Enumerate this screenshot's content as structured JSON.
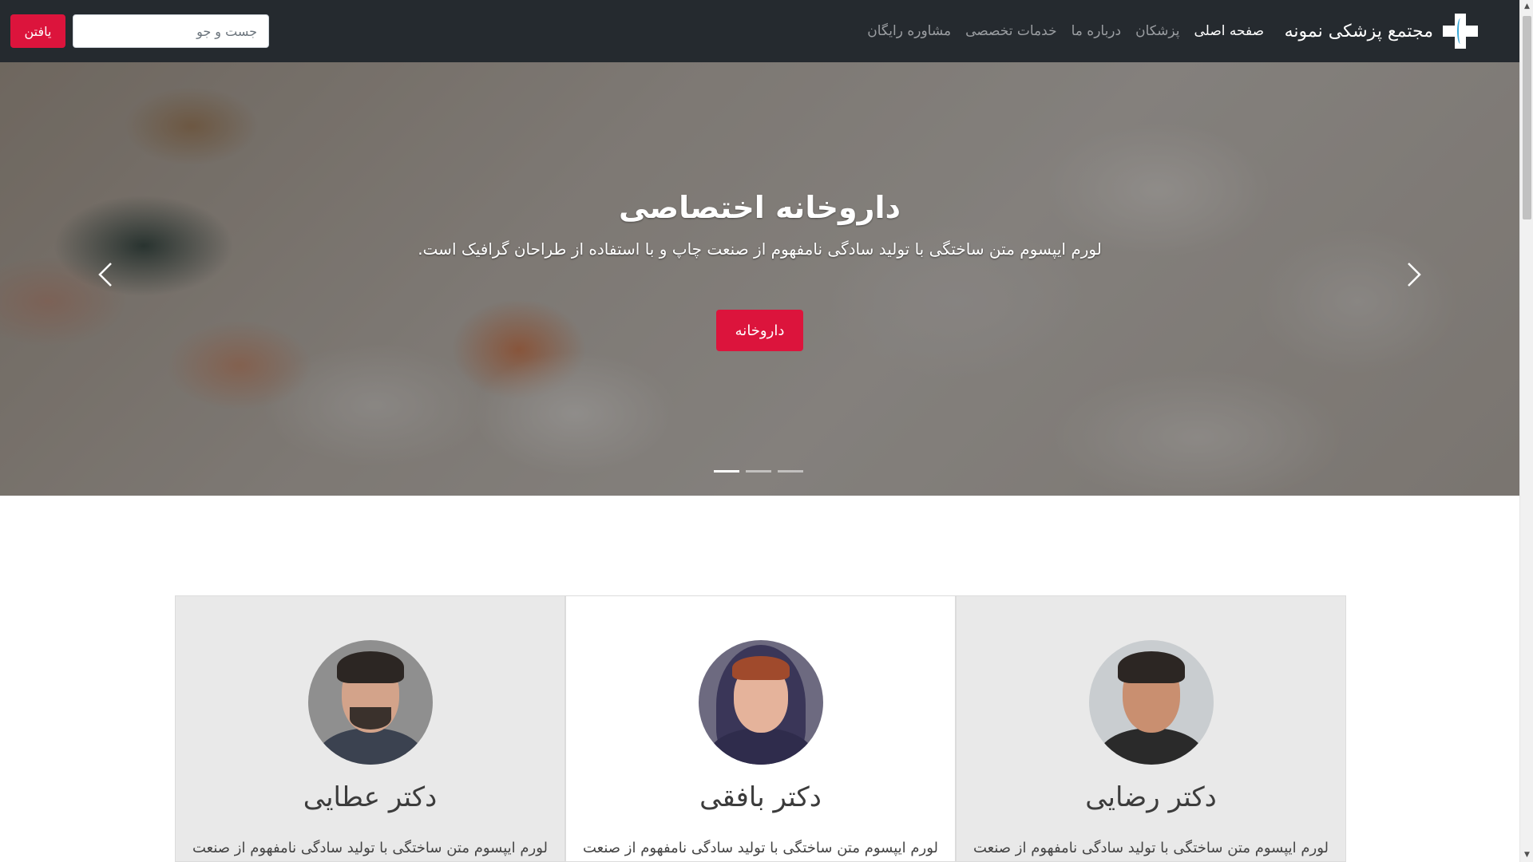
{
  "navbar": {
    "brand_name": "مجتمع پزشکی نمونه",
    "links": [
      "صفحه اصلی",
      "پزشکان",
      "درباره ما",
      "خدمات تخصصی",
      "مشاوره رایگان"
    ],
    "active_link": "صفحه اصلی",
    "search_placeholder": "جست و جو",
    "search_button": "یافتن"
  },
  "hero": {
    "title": "داروخانه اختصاصی",
    "text": "لورم ایپسوم متن ساختگی با تولید سادگی نامفهوم از صنعت چاپ و با استفاده از طراحان گرافیک است.",
    "button": "داروخانه",
    "slides_count": 3,
    "active_slide": 1
  },
  "doctors": [
    {
      "name": "دکتر رضایی",
      "text": "لورم ایپسوم متن ساختگی با تولید سادگی نامفهوم از صنعت"
    },
    {
      "name": "دکتر بافقی",
      "text": "لورم ایپسوم متن ساختگی با تولید سادگی نامفهوم از صنعت"
    },
    {
      "name": "دکتر عطایی",
      "text": "لورم ایپسوم متن ساختگی با تولید سادگی نامفهوم از صنعت"
    }
  ],
  "colors": {
    "navbar_bg": "#252a2f",
    "accent": "#dc143c",
    "card_bg": "#e9e9e9"
  }
}
